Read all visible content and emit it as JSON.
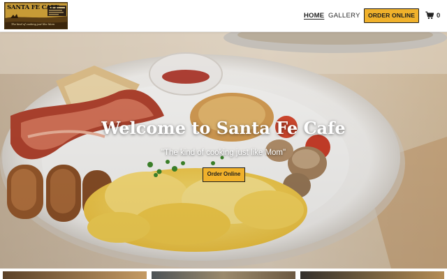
{
  "header": {
    "logo": {
      "title": "SANTA FE CAFE",
      "tagline": "The kind of cooking just like Mom"
    },
    "nav": {
      "home_label": "HOME",
      "gallery_label": "GALLERY",
      "active": "HOME"
    },
    "order_button_label": "ORDER ONLINE",
    "cart": {
      "icon": "shopping-cart-icon",
      "count": "0"
    }
  },
  "hero": {
    "title": "Welcome to Santa Fe Cafe",
    "subtitle": "\"The kind of cooking just like Mom\"",
    "button_label": "Order Online"
  },
  "colors": {
    "accent": "#f0b12b",
    "button_border": "#1d1d1d",
    "text_dark": "#1e1e1e"
  }
}
